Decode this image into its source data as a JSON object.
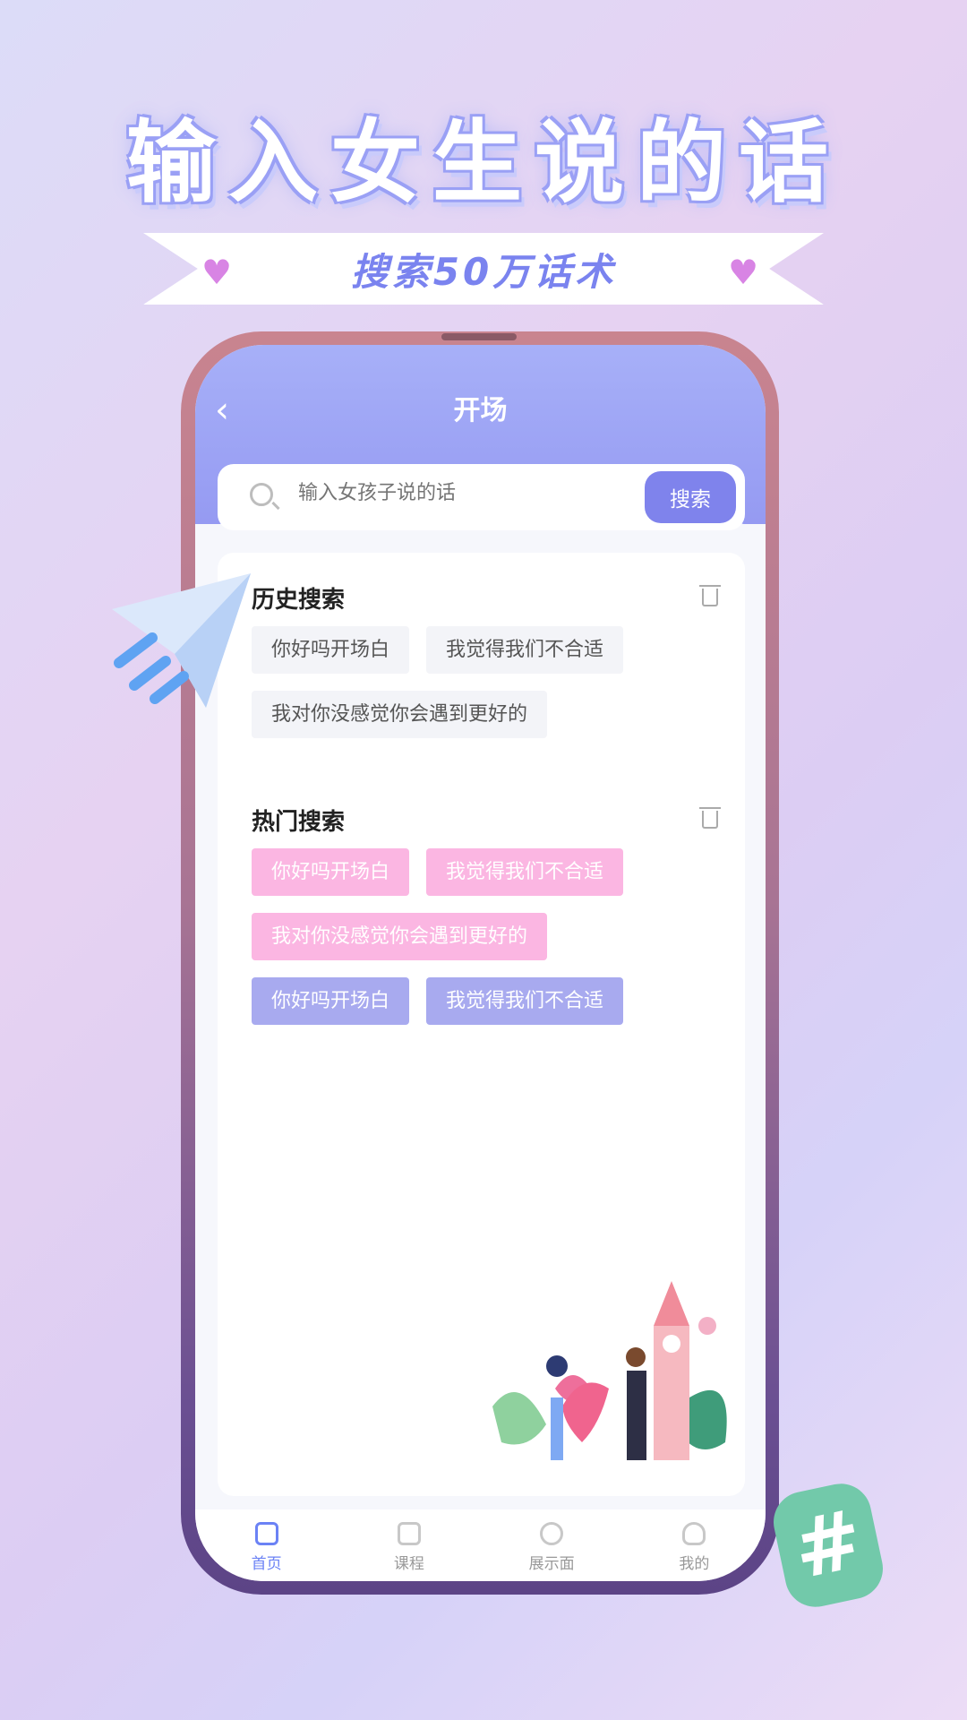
{
  "promo": {
    "headline": "输入女生说的话",
    "subline": "搜索50万话术"
  },
  "header": {
    "title": "开场",
    "back_icon": "chevron-left-icon"
  },
  "search": {
    "placeholder": "输入女孩子说的话",
    "value": "",
    "button": "搜索"
  },
  "history": {
    "title": "历史搜索",
    "tags": [
      "你好吗开场白",
      "我觉得我们不合适",
      "我对你没感觉你会遇到更好的"
    ]
  },
  "hot": {
    "title": "热门搜索",
    "tags": [
      "你好吗开场白",
      "我觉得我们不合适",
      "我对你没感觉你会遇到更好的",
      "你好吗开场白",
      "我觉得我们不合适"
    ]
  },
  "tabs": [
    {
      "label": "首页",
      "icon": "store-icon",
      "active": true
    },
    {
      "label": "课程",
      "icon": "book-icon"
    },
    {
      "label": "展示面",
      "icon": "aperture-icon"
    },
    {
      "label": "我的",
      "icon": "user-icon"
    }
  ],
  "colors": {
    "accent": "#7f83ec",
    "pink_tag": "#fbb6e2",
    "purple_tag": "#a8aaef",
    "active_tab": "#6b82f5"
  }
}
